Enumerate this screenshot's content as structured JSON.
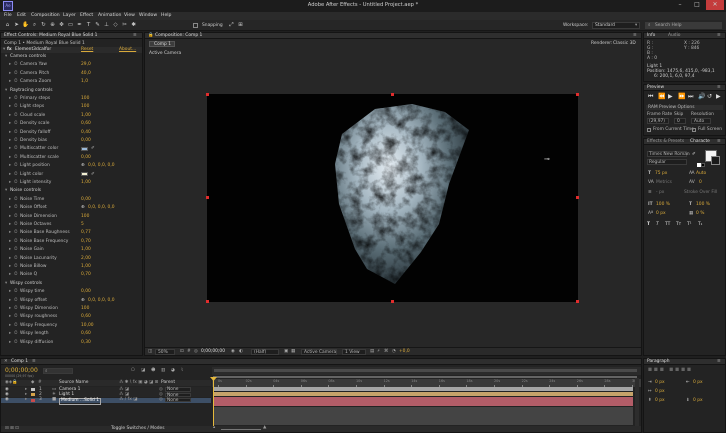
{
  "app": {
    "title": "Adobe After Effects - Untitled Project.aep *",
    "icon_text": "Ae"
  },
  "menubar": [
    "File",
    "Edit",
    "Composition",
    "Layer",
    "Effect",
    "Animation",
    "View",
    "Window",
    "Help"
  ],
  "toolbar": {
    "snapping_label": "Snapping",
    "workspace_label": "Workspace:",
    "workspace_value": "Standard",
    "search_placeholder": "Search Help"
  },
  "effect_controls": {
    "tab_label": "Effect Controls: Medium Royal Blue Solid 1",
    "breadcrumb": "Comp 1 • Medium Royal Blue Solid 1",
    "effect_name": "Element3dcalfor",
    "reset_label": "Reset",
    "about_label": "About...",
    "rows": [
      {
        "label": "Camera controls",
        "value": "",
        "indent": 1,
        "group": true
      },
      {
        "label": "Camera Yaw",
        "value": "29,0",
        "indent": 2
      },
      {
        "label": "Camera Pitch",
        "value": "40,0",
        "indent": 2
      },
      {
        "label": "Camera Zoom",
        "value": "1,0",
        "indent": 2
      },
      {
        "label": "Raytracing controls",
        "value": "",
        "indent": 1,
        "group": true
      },
      {
        "label": "Primary steps",
        "value": "100",
        "indent": 2
      },
      {
        "label": "Light steps",
        "value": "100",
        "indent": 2
      },
      {
        "label": "Cloud scale",
        "value": "1,00",
        "indent": 2
      },
      {
        "label": "Density scale",
        "value": "0,60",
        "indent": 2
      },
      {
        "label": "Density falloff",
        "value": "0,40",
        "indent": 2
      },
      {
        "label": "Density bias",
        "value": "0,00",
        "indent": 2
      },
      {
        "label": "Multiscatter color",
        "value": "",
        "indent": 2,
        "swatch": "#9ab8d8"
      },
      {
        "label": "Multiscatter scale",
        "value": "0,00",
        "indent": 2
      },
      {
        "label": "Light position",
        "value": "0,0, 0,0, 0,0",
        "indent": 2,
        "crosshair": true
      },
      {
        "label": "Light color",
        "value": "",
        "indent": 2,
        "swatch": "#f2efd2"
      },
      {
        "label": "Light intensity",
        "value": "1,00",
        "indent": 2
      },
      {
        "label": "Noise controls",
        "value": "",
        "indent": 1,
        "group": true
      },
      {
        "label": "Noise Time",
        "value": "0,00",
        "indent": 2
      },
      {
        "label": "Noise Offset",
        "value": "0,0, 0,0, 0,0",
        "indent": 2,
        "crosshair": true
      },
      {
        "label": "Noise Dimension",
        "value": "100",
        "indent": 2
      },
      {
        "label": "Noise Octaves",
        "value": "5",
        "indent": 2
      },
      {
        "label": "Noise Base Roughness",
        "value": "0,77",
        "indent": 2
      },
      {
        "label": "Noise Base Frequency",
        "value": "0,70",
        "indent": 2
      },
      {
        "label": "Noise Gain",
        "value": "1,00",
        "indent": 2
      },
      {
        "label": "Noise Lacunarity",
        "value": "2,00",
        "indent": 2
      },
      {
        "label": "Noise Billow",
        "value": "1,00",
        "indent": 2
      },
      {
        "label": "Noise Q",
        "value": "0,70",
        "indent": 2
      },
      {
        "label": "Wispy controls",
        "value": "",
        "indent": 1,
        "group": true
      },
      {
        "label": "Wispy time",
        "value": "0,00",
        "indent": 2
      },
      {
        "label": "Wispy offset",
        "value": "0,0, 0,0, 0,0",
        "indent": 2,
        "crosshair": true
      },
      {
        "label": "Wispy Dimension",
        "value": "100",
        "indent": 2
      },
      {
        "label": "Wispy roughness",
        "value": "0,60",
        "indent": 2
      },
      {
        "label": "Wispy Frequency",
        "value": "10,00",
        "indent": 2
      },
      {
        "label": "Wispy length",
        "value": "0,60",
        "indent": 2
      },
      {
        "label": "Wispy diffusion",
        "value": "0,30",
        "indent": 2
      }
    ]
  },
  "composition": {
    "tab_label": "Composition: Comp 1",
    "subtab": "Comp 1",
    "view_label": "Active Camera",
    "renderer_label": "Renderer:",
    "renderer_value": "Classic 3D",
    "zoom": "50%",
    "timecode": "0;00;00;00",
    "resolution": "(Half)",
    "camera": "Active Camera",
    "views": "1 View",
    "exposure": "+0,0"
  },
  "info": {
    "tab1": "Info",
    "tab2": "Audio",
    "r": "R :",
    "g": "G :",
    "b": "B :",
    "a": "A :  0",
    "x": "X : 226",
    "y": "Y : 846",
    "light_title": "Light 1",
    "light_position": "Position: 1475,6, 415,0, -983,1",
    "light_vals": "6: 200,1, 6,0, 97,4"
  },
  "preview": {
    "tab": "Preview",
    "ram_label": "RAM Preview Options",
    "frame_rate_label": "Frame Rate",
    "skip_label": "Skip",
    "resolution_label": "Resolution",
    "frame_rate": "(29,97)",
    "skip": "0",
    "resolution": "Auto",
    "from_current": "From Current Time",
    "full_screen": "Full Screen"
  },
  "character": {
    "tab1": "Effects & Presets",
    "tab2": "Characte",
    "font": "Times New Roman",
    "style": "Regular",
    "size": "75 px",
    "leading": "Auto",
    "kerning": "Metrics",
    "tracking": "0",
    "stroke": "- px",
    "stroke_mode": "Stroke Over Fill",
    "vscale": "100 %",
    "hscale": "100 %",
    "baseline": "0 px",
    "tsume": "0 %"
  },
  "timeline": {
    "tab": "Comp 1",
    "timecode": "0;00;00;00",
    "fps_note": "00000 (29,97 fps)",
    "col_source": "Source Name",
    "col_parent": "Parent",
    "layers": [
      {
        "num": "1",
        "name": "Camera 1",
        "parent": "None",
        "color": "#c6c6c6"
      },
      {
        "num": "2",
        "name": "Light 1",
        "parent": "None",
        "color": "#d6a44a"
      },
      {
        "num": "3",
        "name": "Medium ...Solid 1",
        "parent": "None",
        "color": "#c94b4b"
      }
    ],
    "ticks": [
      "0s",
      "02s",
      "04s",
      "06s",
      "08s",
      "10s",
      "12s",
      "14s",
      "16s",
      "18s",
      "20s",
      "22s",
      "24s",
      "26s",
      "28s",
      "30s"
    ],
    "toggle_label": "Toggle Switches / Modes"
  },
  "paragraph": {
    "tab": "Paragraph",
    "v1": "0 px",
    "v2": "0 px",
    "v3": "0 px",
    "v4": "0 px",
    "v5": "0 px"
  }
}
